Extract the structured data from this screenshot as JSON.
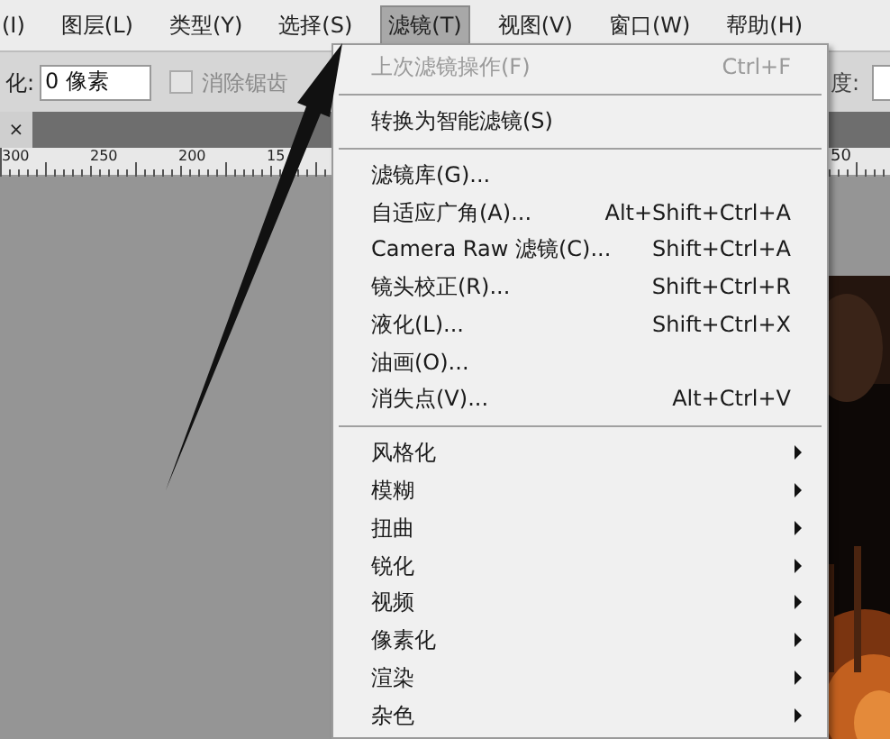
{
  "menubar": [
    {
      "label": "(I)",
      "selected": false
    },
    {
      "label": "图层(L)",
      "selected": false
    },
    {
      "label": "类型(Y)",
      "selected": false
    },
    {
      "label": "选择(S)",
      "selected": false
    },
    {
      "label": "滤镜(T)",
      "selected": true
    },
    {
      "label": "视图(V)",
      "selected": false
    },
    {
      "label": "窗口(W)",
      "selected": false
    },
    {
      "label": "帮助(H)",
      "selected": false
    }
  ],
  "options_bar": {
    "feather_label": "化:",
    "feather_value": "0 像素",
    "anti_alias": {
      "label": "消除锯齿",
      "checked": false,
      "disabled": true
    },
    "right_label": "度:"
  },
  "document_tab": {
    "close": "×"
  },
  "ruler": {
    "labels": [
      "300",
      "250",
      "200",
      "15"
    ],
    "right_label": "50"
  },
  "filter_menu": [
    {
      "kind": "item",
      "label": "上次滤镜操作(F)",
      "shortcut": "Ctrl+F",
      "disabled": true,
      "submenu": false
    },
    {
      "kind": "separator"
    },
    {
      "kind": "item",
      "label": "转换为智能滤镜(S)",
      "disabled": false,
      "submenu": false
    },
    {
      "kind": "separator"
    },
    {
      "kind": "item",
      "label": "滤镜库(G)...",
      "disabled": false,
      "submenu": false
    },
    {
      "kind": "item",
      "label": "自适应广角(A)...",
      "shortcut": "Alt+Shift+Ctrl+A",
      "disabled": false,
      "submenu": false
    },
    {
      "kind": "item",
      "label": "Camera Raw 滤镜(C)...",
      "shortcut": "Shift+Ctrl+A",
      "disabled": false,
      "submenu": false
    },
    {
      "kind": "item",
      "label": "镜头校正(R)...",
      "shortcut": "Shift+Ctrl+R",
      "disabled": false,
      "submenu": false
    },
    {
      "kind": "item",
      "label": "液化(L)...",
      "shortcut": "Shift+Ctrl+X",
      "disabled": false,
      "submenu": false
    },
    {
      "kind": "item",
      "label": "油画(O)...",
      "disabled": false,
      "submenu": false
    },
    {
      "kind": "item",
      "label": "消失点(V)...",
      "shortcut": "Alt+Ctrl+V",
      "disabled": false,
      "submenu": false
    },
    {
      "kind": "separator"
    },
    {
      "kind": "item",
      "label": "风格化",
      "disabled": false,
      "submenu": true
    },
    {
      "kind": "item",
      "label": "模糊",
      "disabled": false,
      "submenu": true
    },
    {
      "kind": "item",
      "label": "扭曲",
      "disabled": false,
      "submenu": true
    },
    {
      "kind": "item",
      "label": "锐化",
      "disabled": false,
      "submenu": true
    },
    {
      "kind": "item",
      "label": "视频",
      "disabled": false,
      "submenu": true
    },
    {
      "kind": "item",
      "label": "像素化",
      "disabled": false,
      "submenu": true
    },
    {
      "kind": "item",
      "label": "渲染",
      "disabled": false,
      "submenu": true
    },
    {
      "kind": "item",
      "label": "杂色",
      "disabled": false,
      "submenu": true
    }
  ]
}
